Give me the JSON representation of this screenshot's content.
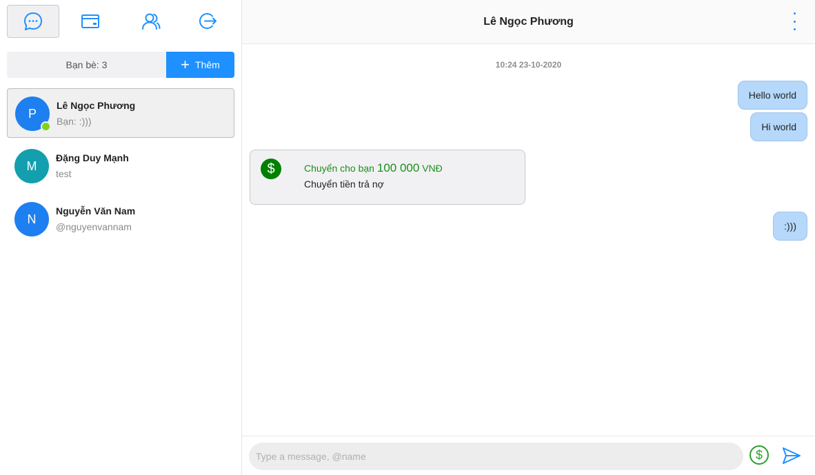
{
  "nav": {
    "items": [
      {
        "icon": "chat-bubble-icon",
        "active": true
      },
      {
        "icon": "card-icon",
        "active": false
      },
      {
        "icon": "contacts-icon",
        "active": false
      },
      {
        "icon": "logout-icon",
        "active": false
      }
    ]
  },
  "friends": {
    "count_label": "Bạn bè: 3",
    "add_label": "Thêm"
  },
  "contacts": [
    {
      "initial": "P",
      "name": "Lê Ngọc Phương",
      "preview": "Bạn: :)))",
      "color": "#1e7ff0",
      "online": true,
      "active": true
    },
    {
      "initial": "M",
      "name": "Đặng Duy Mạnh",
      "preview": "test",
      "color": "#139fae",
      "online": false,
      "active": false
    },
    {
      "initial": "N",
      "name": "Nguyễn Văn Nam",
      "preview": "@nguyenvannam",
      "color": "#1e7ff0",
      "online": false,
      "active": false
    }
  ],
  "chat": {
    "title": "Lê Ngọc Phương",
    "timestamp": "10:24 23-10-2020",
    "messages": [
      {
        "type": "out",
        "text": "Hello world"
      },
      {
        "type": "out",
        "text": "Hi world"
      },
      {
        "type": "transfer",
        "prefix": "Chuyển cho bạn",
        "amount": "100 000",
        "currency": "VNĐ",
        "note": "Chuyển tiền trả nợ"
      },
      {
        "type": "out",
        "text": ":)))"
      }
    ]
  },
  "composer": {
    "placeholder": "Type a message, @name",
    "value": ""
  },
  "colors": {
    "accent": "#1e90ff",
    "money": "#008000",
    "outgoing_bubble": "#b5d8fb"
  }
}
